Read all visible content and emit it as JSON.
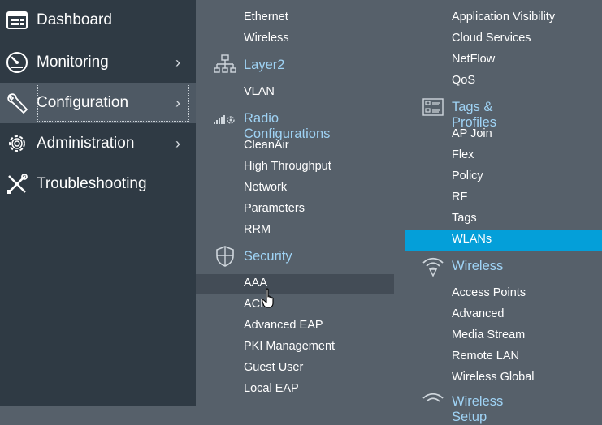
{
  "nav": {
    "items": [
      {
        "label": "Dashboard",
        "icon": "dashboard-icon",
        "chevron": false
      },
      {
        "label": "Monitoring",
        "icon": "gauge-icon",
        "chevron": true
      },
      {
        "label": "Configuration",
        "icon": "wrench-icon",
        "chevron": true,
        "active": true
      },
      {
        "label": "Administration",
        "icon": "gear-icon",
        "chevron": true
      },
      {
        "label": "Troubleshooting",
        "icon": "tools-icon",
        "chevron": false
      }
    ],
    "chevron_glyph": "›"
  },
  "menu": {
    "col1": {
      "top_items": [
        "Ethernet",
        "Wireless"
      ],
      "layer2": {
        "title": "Layer2",
        "items": [
          "VLAN"
        ]
      },
      "radio": {
        "title": "Radio Configurations",
        "items": [
          "CleanAir",
          "High Throughput",
          "Network",
          "Parameters",
          "RRM"
        ]
      },
      "security": {
        "title": "Security",
        "items": [
          "AAA",
          "ACL",
          "Advanced EAP",
          "PKI Management",
          "Guest User",
          "Local EAP"
        ]
      }
    },
    "col2": {
      "top_items": [
        "Application Visibility",
        "Cloud Services",
        "NetFlow",
        "QoS"
      ],
      "tags": {
        "title": "Tags & Profiles",
        "items": [
          "AP Join",
          "Flex",
          "Policy",
          "RF",
          "Tags",
          "WLANs"
        ]
      },
      "wireless": {
        "title": "Wireless",
        "items": [
          "Access Points",
          "Advanced",
          "Media Stream",
          "Remote LAN",
          "Wireless Global"
        ]
      },
      "wireless_setup": {
        "title": "Wireless Setup"
      }
    }
  },
  "colors": {
    "nav_bg": "#2f3a44",
    "menu_bg": "#56606a",
    "section_title": "#9fd3f5",
    "selected": "#049fd9",
    "hover": "#434c56"
  }
}
